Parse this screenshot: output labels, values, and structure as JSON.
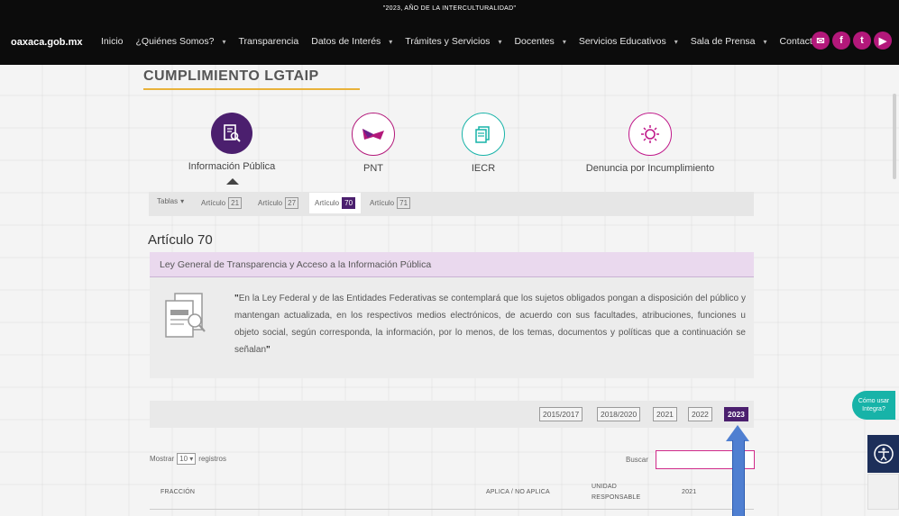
{
  "header": {
    "slogan": "\"2023, AÑO DE LA INTERCULTURALIDAD\"",
    "brand": "oaxaca.gob.mx",
    "nav": [
      {
        "label": "Inicio",
        "dropdown": false
      },
      {
        "label": "¿Quiénes Somos?",
        "dropdown": true
      },
      {
        "label": "Transparencia",
        "dropdown": false
      },
      {
        "label": "Datos de Interés",
        "dropdown": true
      },
      {
        "label": "Trámites y Servicios",
        "dropdown": true
      },
      {
        "label": "Docentes",
        "dropdown": true
      },
      {
        "label": "Servicios Educativos",
        "dropdown": true
      },
      {
        "label": "Sala de Prensa",
        "dropdown": true
      },
      {
        "label": "Contacto",
        "dropdown": true
      }
    ],
    "social": [
      "email-icon",
      "facebook-icon",
      "twitter-icon",
      "youtube-icon"
    ]
  },
  "page": {
    "title": "CUMPLIMIENTO LGTAIP",
    "categories": [
      {
        "label": "Información Pública",
        "icon": "document-search-icon"
      },
      {
        "label": "PNT",
        "icon": "pnt-logo-icon"
      },
      {
        "label": "IECR",
        "icon": "documents-icon"
      },
      {
        "label": "Denuncia por Incumplimiento",
        "icon": "alert-icon"
      }
    ],
    "tabs": {
      "menu_label": "Tablas",
      "items": [
        {
          "label": "Artículo",
          "num": "21"
        },
        {
          "label": "Artículo",
          "num": "27"
        },
        {
          "label": "Artículo",
          "num": "70"
        },
        {
          "label": "Artículo",
          "num": "71"
        }
      ],
      "active": "70"
    },
    "article_title": "Artículo 70",
    "law_name": "Ley General de Transparencia y Acceso a la Información Pública",
    "quote": "En la Ley Federal y de las Entidades Federativas se contemplará que los sujetos obligados pongan a disposición del público y mantengan actualizada, en los respectivos medios electrónicos, de acuerdo con sus facultades, atribuciones, funciones u objeto social, según corresponda, la información, por lo menos, de los temas, documentos y políticas que a continuación se señalan",
    "years": [
      "2015/2017",
      "2018/2020",
      "2021",
      "2022",
      "2023"
    ],
    "active_year": "2023",
    "table": {
      "show_prefix": "Mostrar",
      "show_value": "10",
      "show_suffix": "registros",
      "search_label": "Buscar",
      "columns": [
        "FRACCIÓN",
        "APLICA / NO APLICA",
        "UNIDAD RESPONSABLE",
        "2021"
      ]
    }
  },
  "widgets": {
    "helper": "Cómo usar Integra?"
  },
  "colors": {
    "accent": "#4b1f6e",
    "magenta": "#b3187a",
    "teal": "#17b3a8",
    "gold": "#e8b23a"
  }
}
